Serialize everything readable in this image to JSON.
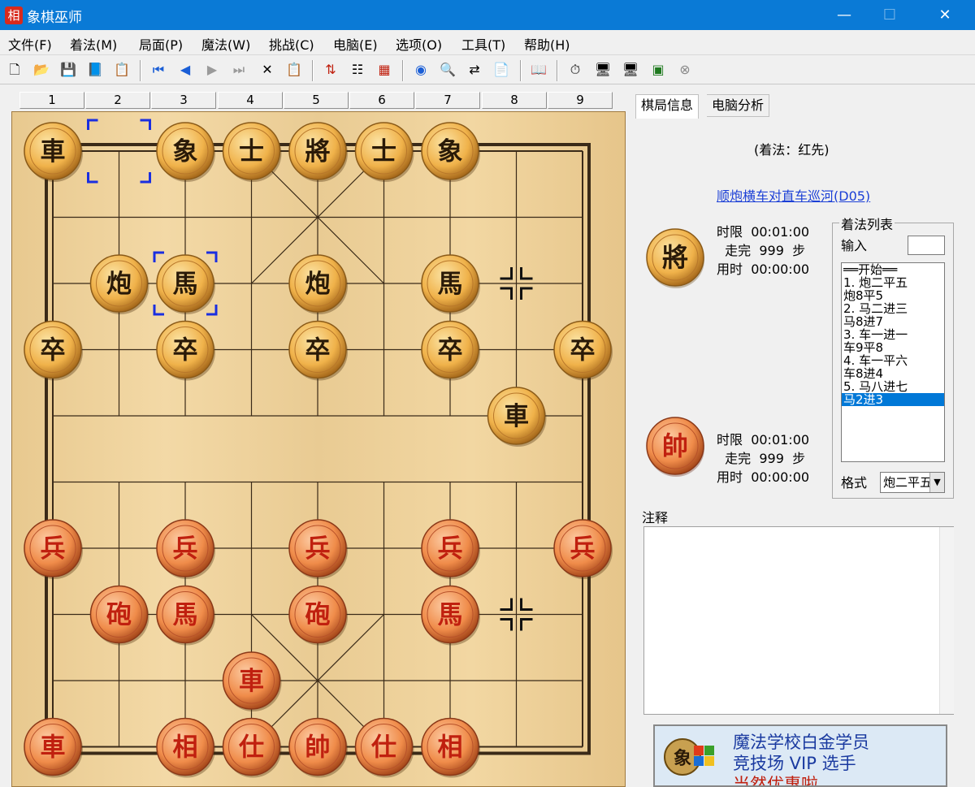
{
  "window": {
    "title": "象棋巫师",
    "icon_glyph": "相",
    "minimize": "—",
    "maximize": "☐",
    "close": "✕"
  },
  "menu": [
    "文件(F)",
    "着法(M)",
    "局面(P)",
    "魔法(W)",
    "挑战(C)",
    "电脑(E)",
    "选项(O)",
    "工具(T)",
    "帮助(H)"
  ],
  "toolbar": [
    {
      "name": "new-file-icon",
      "glyph": "🗋"
    },
    {
      "name": "open-folder-icon",
      "glyph": "📂"
    },
    {
      "name": "save-icon",
      "glyph": "💾"
    },
    {
      "name": "book-icon",
      "glyph": "📘"
    },
    {
      "name": "properties-icon",
      "glyph": "📋"
    },
    {
      "name": "first-move-icon",
      "glyph": "⏮"
    },
    {
      "name": "prev-move-icon",
      "glyph": "◀"
    },
    {
      "name": "next-move-icon",
      "glyph": "▶"
    },
    {
      "name": "last-move-icon",
      "glyph": "⏭"
    },
    {
      "name": "delete-icon",
      "glyph": "✕"
    },
    {
      "name": "paste-icon",
      "glyph": "📋"
    },
    {
      "name": "flip-board-icon",
      "glyph": "⇅"
    },
    {
      "name": "tree-icon",
      "glyph": "☷"
    },
    {
      "name": "calculator-icon",
      "glyph": "▦"
    },
    {
      "name": "color-wheel-icon",
      "glyph": "◉"
    },
    {
      "name": "search-position-icon",
      "glyph": "🔍"
    },
    {
      "name": "export-icon",
      "glyph": "⇄"
    },
    {
      "name": "clipboard-icon",
      "glyph": "📄"
    },
    {
      "name": "opening-book-icon",
      "glyph": "📖"
    },
    {
      "name": "clock-icon",
      "glyph": "⏱"
    },
    {
      "name": "computer-icon",
      "glyph": "🖥"
    },
    {
      "name": "computer2-icon",
      "glyph": "🖥"
    },
    {
      "name": "monitor-icon",
      "glyph": "▣"
    },
    {
      "name": "stop-icon",
      "glyph": "⊗"
    }
  ],
  "columns": [
    "1",
    "2",
    "3",
    "4",
    "5",
    "6",
    "7",
    "8",
    "9"
  ],
  "colors": {
    "red": "#c0200f",
    "black": "#2a1a08",
    "board_line": "#3a2a18",
    "selection": "#1a2ee0",
    "link": "#1b3fd6"
  },
  "board": {
    "pieces": [
      {
        "char": "車",
        "side": "black",
        "file": 0,
        "rank": 0
      },
      {
        "char": "象",
        "side": "black",
        "file": 2,
        "rank": 0
      },
      {
        "char": "士",
        "side": "black",
        "file": 3,
        "rank": 0
      },
      {
        "char": "將",
        "side": "black",
        "file": 4,
        "rank": 0
      },
      {
        "char": "士",
        "side": "black",
        "file": 5,
        "rank": 0
      },
      {
        "char": "象",
        "side": "black",
        "file": 6,
        "rank": 0
      },
      {
        "char": "炮",
        "side": "black",
        "file": 1,
        "rank": 2
      },
      {
        "char": "馬",
        "side": "black",
        "file": 2,
        "rank": 2
      },
      {
        "char": "炮",
        "side": "black",
        "file": 4,
        "rank": 2
      },
      {
        "char": "馬",
        "side": "black",
        "file": 6,
        "rank": 2
      },
      {
        "char": "卒",
        "side": "black",
        "file": 0,
        "rank": 3
      },
      {
        "char": "卒",
        "side": "black",
        "file": 2,
        "rank": 3
      },
      {
        "char": "卒",
        "side": "black",
        "file": 4,
        "rank": 3
      },
      {
        "char": "卒",
        "side": "black",
        "file": 6,
        "rank": 3
      },
      {
        "char": "卒",
        "side": "black",
        "file": 8,
        "rank": 3
      },
      {
        "char": "車",
        "side": "black",
        "file": 7,
        "rank": 4
      },
      {
        "char": "兵",
        "side": "red",
        "file": 0,
        "rank": 6
      },
      {
        "char": "兵",
        "side": "red",
        "file": 2,
        "rank": 6
      },
      {
        "char": "兵",
        "side": "red",
        "file": 4,
        "rank": 6
      },
      {
        "char": "兵",
        "side": "red",
        "file": 6,
        "rank": 6
      },
      {
        "char": "兵",
        "side": "red",
        "file": 8,
        "rank": 6
      },
      {
        "char": "砲",
        "side": "red",
        "file": 1,
        "rank": 7
      },
      {
        "char": "馬",
        "side": "red",
        "file": 2,
        "rank": 7
      },
      {
        "char": "砲",
        "side": "red",
        "file": 4,
        "rank": 7
      },
      {
        "char": "馬",
        "side": "red",
        "file": 6,
        "rank": 7
      },
      {
        "char": "車",
        "side": "red",
        "file": 3,
        "rank": 8
      },
      {
        "char": "車",
        "side": "red",
        "file": 0,
        "rank": 9
      },
      {
        "char": "相",
        "side": "red",
        "file": 2,
        "rank": 9
      },
      {
        "char": "仕",
        "side": "red",
        "file": 3,
        "rank": 9
      },
      {
        "char": "帥",
        "side": "red",
        "file": 4,
        "rank": 9
      },
      {
        "char": "仕",
        "side": "red",
        "file": 5,
        "rank": 9
      },
      {
        "char": "相",
        "side": "red",
        "file": 6,
        "rank": 9
      }
    ],
    "last_move": {
      "from": {
        "file": 1,
        "rank": 0
      },
      "to": {
        "file": 2,
        "rank": 2
      }
    }
  },
  "panel": {
    "tabs": [
      "棋局信息",
      "电脑分析"
    ],
    "move_type": "(着法：红先)",
    "opening": "顺炮横车对直车巡河(D05)",
    "black_player": {
      "piece": "將",
      "limit_label": "时限",
      "limit": "00:01:00",
      "moves_label": "走完",
      "moves": "999",
      "moves_unit": "步",
      "used_label": "用时",
      "used": "00:00:00"
    },
    "red_player": {
      "piece": "帥",
      "limit_label": "时限",
      "limit": "00:01:00",
      "moves_label": "走完",
      "moves": "999",
      "moves_unit": "步",
      "used_label": "用时",
      "used": "00:00:00"
    },
    "movelist": {
      "legend": "着法列表",
      "input_label": "输入",
      "items": [
        "══开始══",
        "1. 炮二平五",
        "   炮8平5",
        "2. 马二进三",
        "   马8进7",
        "3. 车一进一",
        "   车9平8",
        "4. 车一平六",
        "   车8进4",
        "5. 马八进七",
        "   马2进3"
      ],
      "selected": 10,
      "format_label": "格式",
      "format_value": "炮二平五"
    },
    "note_label": "注释",
    "banner": [
      "魔法学校白金学员",
      "竞技场 VIP 选手",
      "当然优惠啦"
    ]
  }
}
